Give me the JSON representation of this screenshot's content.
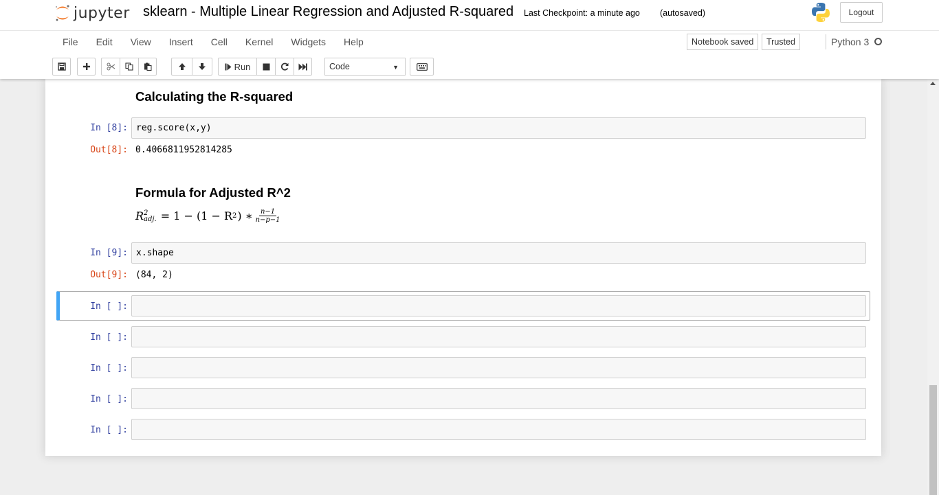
{
  "header": {
    "logo_text": "jupyter",
    "notebook_title": "sklearn - Multiple Linear Regression and Adjusted R-squared",
    "checkpoint": "Last Checkpoint: a minute ago",
    "autosave_status": "(autosaved)",
    "logout_label": "Logout"
  },
  "menu": {
    "items": [
      "File",
      "Edit",
      "View",
      "Insert",
      "Cell",
      "Kernel",
      "Widgets",
      "Help"
    ]
  },
  "status": {
    "notebook_saved": "Notebook saved",
    "trusted": "Trusted",
    "kernel": "Python 3"
  },
  "toolbar": {
    "run_label": "Run",
    "cell_type": "Code"
  },
  "cells": {
    "heading1": "Calculating the R-squared",
    "c8_prompt": "In [8]:",
    "c8_code": "reg.score(x,y)",
    "c8_out_prompt": "Out[8]:",
    "c8_output": "0.4066811952814285",
    "heading2": "Formula for Adjusted R^2",
    "c9_prompt": "In [9]:",
    "c9_code": "x.shape",
    "c9_out_prompt": "Out[9]:",
    "c9_output": "(84, 2)",
    "empty_prompt": "In [ ]:"
  },
  "formula": {
    "lhs": "R",
    "lhs_sup": "2",
    "lhs_sub": "adj.",
    "rhs": "= 1 − (1 − R",
    "rhs_sup": "2",
    "rhs_tail": ") ∗",
    "numerator": "n−1",
    "denominator": "n−p−1"
  },
  "colors": {
    "in_prompt": "#303f9f",
    "out_prompt": "#d84315",
    "selected_border": "#42a5f5"
  }
}
